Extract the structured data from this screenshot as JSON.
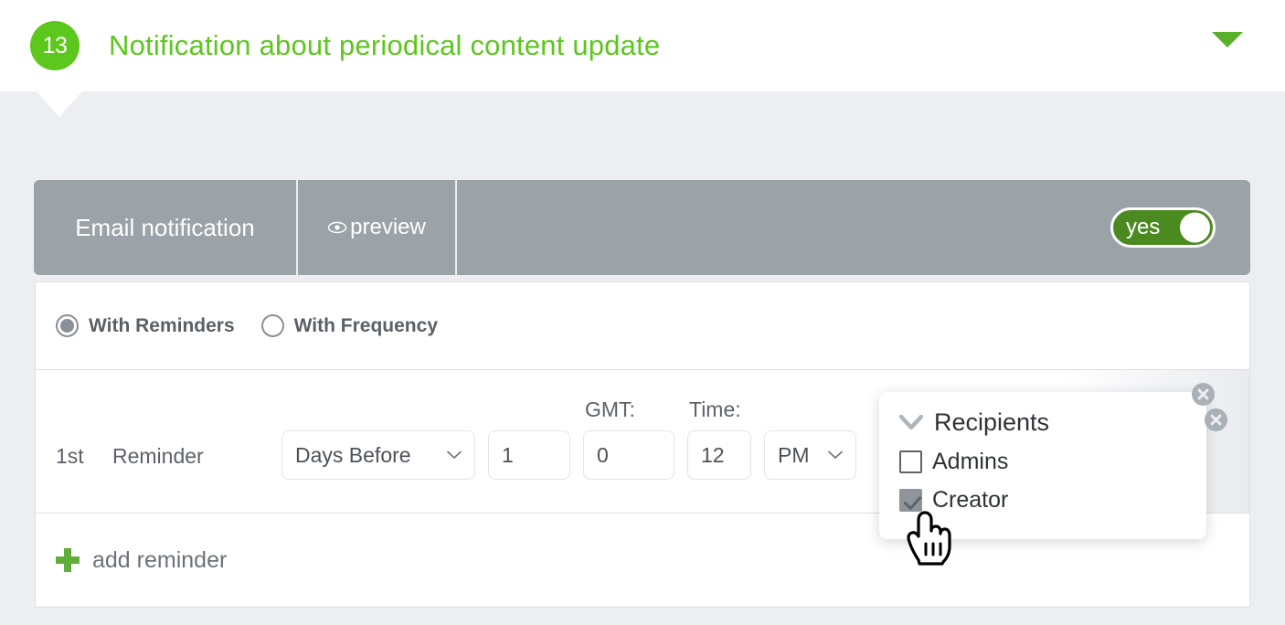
{
  "header": {
    "badge_count": "13",
    "title": "Notification about periodical content update",
    "chevron_icon": "chevron-down-icon",
    "accent_green": "#5cc71c"
  },
  "toolbar": {
    "title": "Email notification",
    "preview_label": "preview",
    "preview_icon": "eye-icon",
    "toggle": {
      "label": "yes",
      "state": "on",
      "on_color": "#4b8a21"
    },
    "background": "#9ba2a8"
  },
  "mode_selector": {
    "options": [
      {
        "label": "With Reminders",
        "selected": true
      },
      {
        "label": "With Frequency",
        "selected": false
      }
    ]
  },
  "reminder": {
    "ordinal": "1st",
    "word": "Reminder",
    "offset_select": {
      "value": "Days Before",
      "icon": "chevron-down-icon"
    },
    "offset_value": "1",
    "gmt_label": "GMT:",
    "gmt_value": "0",
    "time_label": "Time:",
    "time_value": "12",
    "meridiem_select": {
      "value": "PM",
      "icon": "chevron-down-icon"
    }
  },
  "add_reminder": {
    "label": "add reminder",
    "icon": "plus-icon"
  },
  "recipients_popover": {
    "title": "Recipients",
    "collapse_icon": "chevron-down-icon",
    "items": [
      {
        "label": "Admins",
        "checked": false
      },
      {
        "label": "Creator",
        "checked": true
      }
    ],
    "close_icons": [
      "close-icon",
      "close-icon"
    ]
  },
  "cursor": {
    "type": "pointing-hand-cursor"
  }
}
